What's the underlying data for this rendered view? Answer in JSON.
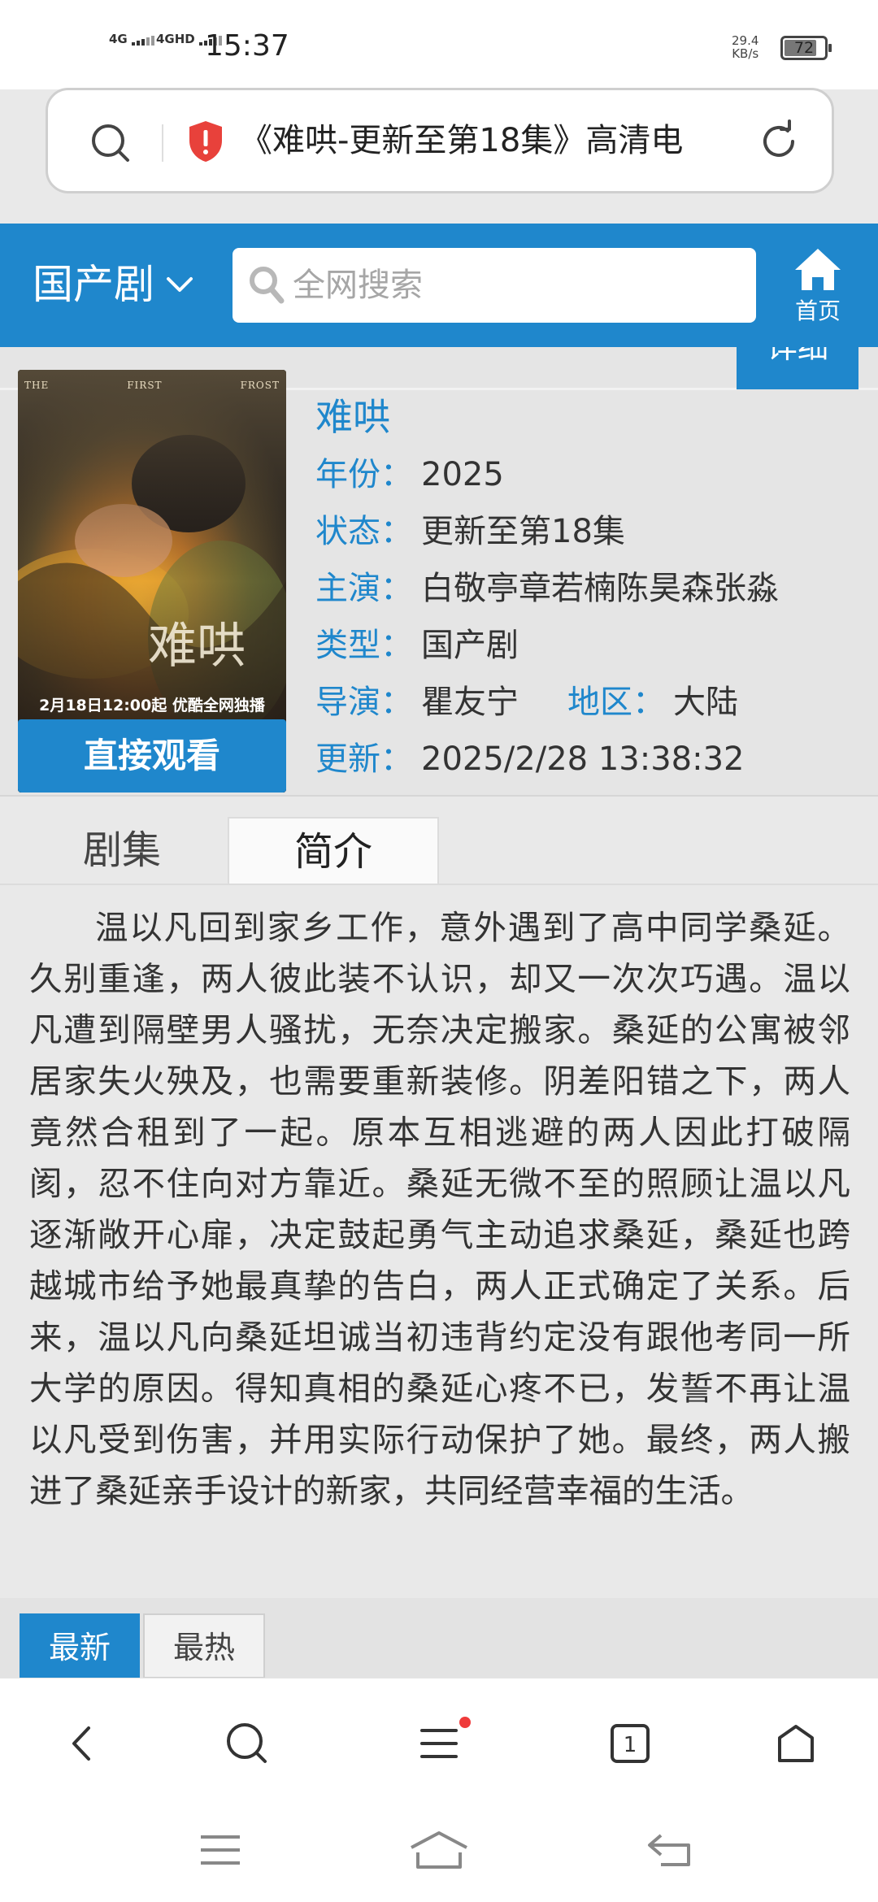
{
  "status_bar": {
    "signal_1": "4G",
    "signal_2": "4GHD",
    "time": "15:37",
    "speed_value": "29.4",
    "speed_unit": "KB/s",
    "battery": "72"
  },
  "url_bar": {
    "text": "《难哄-更新至第18集》高清电",
    "security_icon": "shield-alert-icon"
  },
  "header": {
    "category": "国产剧",
    "search_placeholder": "全网搜索",
    "home_label": "首页",
    "accent": "#1f87cc"
  },
  "detail": {
    "tab_label": "详细",
    "poster": {
      "top_words": [
        "THE",
        "FIRST",
        "FROST"
      ],
      "release_text": "2月18日12:00起 优酷全网独播"
    },
    "watch_button": "直接观看",
    "title": "难哄",
    "rows": {
      "year_label": "年份：",
      "year": "2025",
      "status_label": "状态：",
      "status": "更新至第18集",
      "cast_label": "主演：",
      "cast": "白敬亭章若楠陈昊森张淼",
      "genre_label": "类型：",
      "genre": "国产剧",
      "director_label": "导演：",
      "director": "瞿友宁",
      "region_label": "地区：",
      "region": "大陆",
      "updated_label": "更新：",
      "updated": "2025/2/28 13:38:32"
    }
  },
  "tabs": {
    "episodes": "剧集",
    "intro": "简介",
    "active": "intro"
  },
  "synopsis": "温以凡回到家乡工作，意外遇到了高中同学桑延。久别重逢，两人彼此装不认识，却又一次次巧遇。温以凡遭到隔壁男人骚扰，无奈决定搬家。桑延的公寓被邻居家失火殃及，也需要重新装修。阴差阳错之下，两人竟然合租到了一起。原本互相逃避的两人因此打破隔阂，忍不住向对方靠近。桑延无微不至的照顾让温以凡逐渐敞开心扉，决定鼓起勇气主动追求桑延，桑延也跨越城市给予她最真挚的告白，两人正式确定了关系。后来，温以凡向桑延坦诚当初违背约定没有跟他考同一所大学的原因。得知真相的桑延心疼不已，发誓不再让温以凡受到伤害，并用实际行动保护了她。最终，两人搬进了桑延亲手设计的新家，共同经营幸福的生活。",
  "rank_tabs": {
    "latest": "最新",
    "hottest": "最热"
  },
  "browser_bar": {
    "tab_count": "1",
    "icons": [
      "back-icon",
      "search-icon",
      "menu-icon",
      "tabs-icon",
      "home-icon"
    ]
  },
  "system_nav": {
    "icons": [
      "recents-icon",
      "home-icon",
      "back-icon"
    ]
  }
}
